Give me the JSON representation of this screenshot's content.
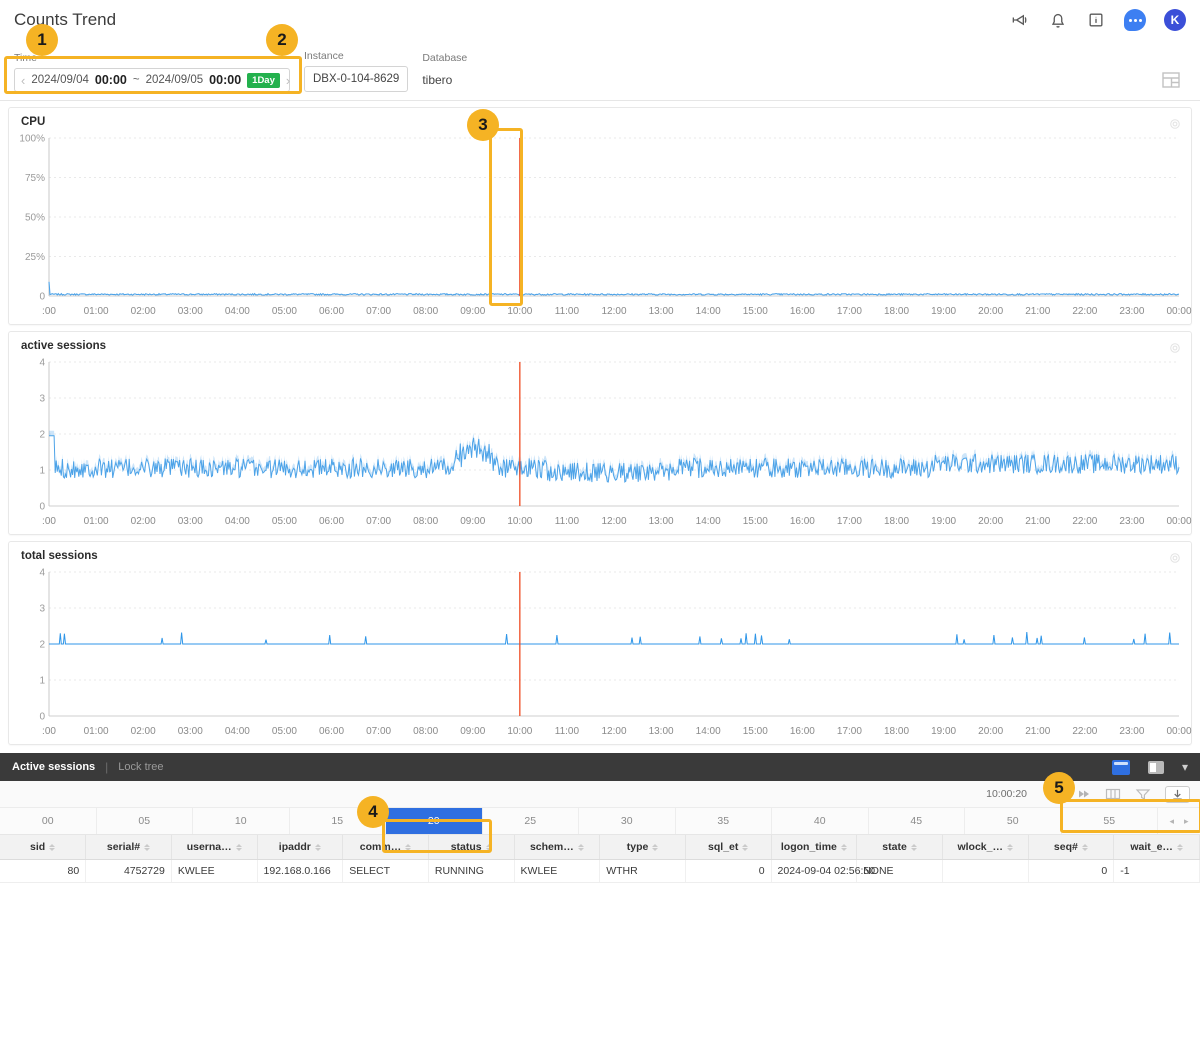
{
  "header": {
    "title": "Counts Trend",
    "icons": [
      {
        "name": "megaphone-icon"
      },
      {
        "name": "bell-icon"
      },
      {
        "name": "info-box-icon"
      },
      {
        "name": "chat-bubble-icon"
      }
    ],
    "avatar_initial": "K"
  },
  "filters": {
    "time_label": "Time",
    "time_start_date": "2024/09/04",
    "time_start_hm": "00:00",
    "separator": "~",
    "time_end_date": "2024/09/05",
    "time_end_hm": "00:00",
    "range_badge": "1Day",
    "prev_arrow": "‹",
    "next_arrow": "›",
    "instance_label": "Instance",
    "instance_value": "DBX-0-104-8629",
    "database_label": "Database",
    "database_value": "tibero"
  },
  "chart_data": [
    {
      "type": "line",
      "title": "CPU",
      "xlabel": "",
      "ylabel": "",
      "ylim": [
        0,
        100
      ],
      "yticks": [
        "0",
        "25%",
        "50%",
        "75%",
        "100%"
      ],
      "xticks": [
        ":00",
        "01:00",
        "02:00",
        "03:00",
        "04:00",
        "05:00",
        "06:00",
        "07:00",
        "08:00",
        "09:00",
        "10:00",
        "11:00",
        "12:00",
        "13:00",
        "14:00",
        "15:00",
        "16:00",
        "17:00",
        "18:00",
        "19:00",
        "20:00",
        "21:00",
        "22:00",
        "23:00",
        "00:00"
      ],
      "grid": true,
      "series_color": "#4da3e8",
      "marker_line": {
        "x_label": "10:00",
        "color": "#ef4b23"
      },
      "values": [
        0.6,
        0.5,
        0.6,
        0.5,
        0.7,
        0.5,
        0.6,
        0.5,
        0.6,
        0.7,
        0.5,
        0.6,
        0.5,
        0.7,
        0.6,
        0.5,
        0.6,
        0.7,
        0.5,
        0.6,
        0.5,
        0.7,
        0.6,
        0.5,
        0.6,
        0.5,
        0.7,
        0.6,
        0.5,
        0.6,
        0.7,
        0.5,
        0.6,
        0.5,
        0.6,
        0.7,
        0.5,
        0.6,
        0.5,
        0.7,
        0.6,
        0.5,
        0.6,
        0.5,
        0.7,
        0.6,
        0.5,
        0.6
      ]
    },
    {
      "type": "line",
      "title": "active sessions",
      "xlabel": "",
      "ylabel": "",
      "ylim": [
        0,
        4
      ],
      "yticks": [
        "0",
        "1",
        "2",
        "3",
        "4"
      ],
      "xticks": [
        ":00",
        "01:00",
        "02:00",
        "03:00",
        "04:00",
        "05:00",
        "06:00",
        "07:00",
        "08:00",
        "09:00",
        "10:00",
        "11:00",
        "12:00",
        "13:00",
        "14:00",
        "15:00",
        "16:00",
        "17:00",
        "18:00",
        "19:00",
        "20:00",
        "21:00",
        "22:00",
        "23:00",
        "00:00"
      ],
      "grid": true,
      "series_color": "#4da3e8",
      "marker_line": {
        "x_label": "10:00",
        "color": "#ef4b23"
      },
      "baseline": 1.05,
      "peak_at": "09:00",
      "peak_value": 2.0
    },
    {
      "type": "line",
      "title": "total sessions",
      "xlabel": "",
      "ylabel": "",
      "ylim": [
        0,
        4
      ],
      "yticks": [
        "0",
        "1",
        "2",
        "3",
        "4"
      ],
      "xticks": [
        ":00",
        "01:00",
        "02:00",
        "03:00",
        "04:00",
        "05:00",
        "06:00",
        "07:00",
        "08:00",
        "09:00",
        "10:00",
        "11:00",
        "12:00",
        "13:00",
        "14:00",
        "15:00",
        "16:00",
        "17:00",
        "18:00",
        "19:00",
        "20:00",
        "21:00",
        "22:00",
        "23:00",
        "00:00"
      ],
      "grid": true,
      "series_color": "#2f96e8",
      "marker_line": {
        "x_label": "10:00",
        "color": "#ef4b23"
      },
      "baseline": 2.0
    }
  ],
  "bottom_panel": {
    "tabs": [
      {
        "label": "Active sessions",
        "active": true
      },
      {
        "label": "Lock tree",
        "active": false
      }
    ],
    "tab_separator": "|",
    "view_icons": [
      {
        "name": "single-pane-icon"
      },
      {
        "name": "split-pane-icon"
      },
      {
        "name": "chevron-down-icon"
      }
    ],
    "toolbar": {
      "timestamp": "10:00:20",
      "icons": [
        {
          "name": "rewind-icon",
          "glyph": "◂◂"
        },
        {
          "name": "fast-forward-icon",
          "glyph": "▸▸"
        },
        {
          "name": "columns-icon"
        },
        {
          "name": "filter-icon"
        },
        {
          "name": "download-icon"
        }
      ]
    },
    "timeline": {
      "cells": [
        "00",
        "05",
        "10",
        "15",
        "20",
        "25",
        "30",
        "35",
        "40",
        "45",
        "50",
        "55"
      ],
      "selected": "20",
      "left_arrow": "◂",
      "right_arrow": "▸"
    },
    "table": {
      "columns": [
        {
          "key": "sid",
          "label": "sid",
          "align": "num"
        },
        {
          "key": "serial",
          "label": "serial#",
          "align": "num"
        },
        {
          "key": "username",
          "label": "userna…",
          "align": "txt"
        },
        {
          "key": "ipaddr",
          "label": "ipaddr",
          "align": "txt"
        },
        {
          "key": "command",
          "label": "comm…",
          "align": "txt"
        },
        {
          "key": "status",
          "label": "status",
          "align": "txt"
        },
        {
          "key": "schema",
          "label": "schem…",
          "align": "txt"
        },
        {
          "key": "type",
          "label": "type",
          "align": "txt"
        },
        {
          "key": "sql_et",
          "label": "sql_et",
          "align": "num"
        },
        {
          "key": "logon_time",
          "label": "logon_time",
          "align": "txt"
        },
        {
          "key": "state",
          "label": "state",
          "align": "txt"
        },
        {
          "key": "wlock",
          "label": "wlock_…",
          "align": "txt"
        },
        {
          "key": "seq",
          "label": "seq#",
          "align": "num"
        },
        {
          "key": "wait_e",
          "label": "wait_e…",
          "align": "txt"
        }
      ],
      "rows": [
        {
          "sid": "80",
          "serial": "4752729",
          "username": "KWLEE",
          "ipaddr": "192.168.0.166",
          "command": "SELECT",
          "status": "RUNNING",
          "schema": "KWLEE",
          "type": "WTHR",
          "sql_et": "0",
          "logon_time": "2024-09-04 02:56:50",
          "state": "NONE",
          "wlock": "",
          "seq": "0",
          "wait_e": "-1"
        }
      ]
    }
  },
  "annotations": [
    {
      "number": "1"
    },
    {
      "number": "2"
    },
    {
      "number": "3"
    },
    {
      "number": "4"
    },
    {
      "number": "5"
    }
  ]
}
